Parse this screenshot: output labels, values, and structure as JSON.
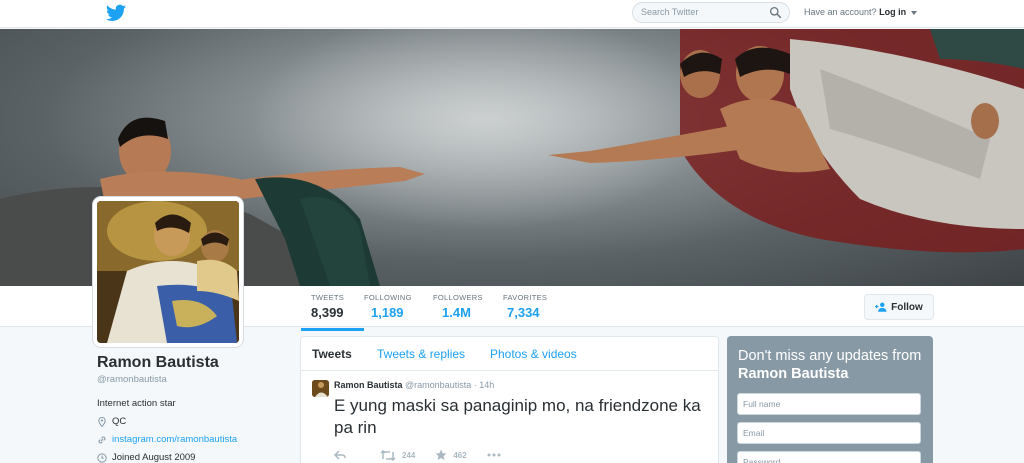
{
  "search": {
    "placeholder": "Search Twitter"
  },
  "account": {
    "prompt": "Have an account?",
    "login_label": "Log in"
  },
  "profile": {
    "name": "Ramon Bautista",
    "handle": "@ramonbautista",
    "bio": "Internet action star",
    "location": "QC",
    "website": "instagram.com/ramonbautista",
    "joined": "Joined August 2009"
  },
  "stats": [
    {
      "label": "TWEETS",
      "value": "8,399"
    },
    {
      "label": "FOLLOWING",
      "value": "1,189"
    },
    {
      "label": "FOLLOWERS",
      "value": "1.4M"
    },
    {
      "label": "FAVORITES",
      "value": "7,334"
    }
  ],
  "follow_label": "Follow",
  "tabs": [
    "Tweets",
    "Tweets & replies",
    "Photos & videos"
  ],
  "tweet": {
    "author": "Ramon Bautista",
    "handle": "@ramonbautista",
    "time": "· 14h",
    "text": "E yung maski sa panaginip mo, na friendzone ka pa rin",
    "retweets": "244",
    "favorites": "462"
  },
  "signup": {
    "heading_prefix": "Don't miss any updates from",
    "heading_name": "Ramon Bautista",
    "fields": [
      "Full name",
      "Email",
      "Password"
    ]
  },
  "colors": {
    "accent": "#1da1f2",
    "signup_bg": "#8899a6"
  },
  "icons": [
    "twitter-bird-icon",
    "search-icon",
    "location-pin-icon",
    "link-icon",
    "calendar-icon",
    "reply-icon",
    "retweet-icon",
    "favorite-star-icon",
    "more-dots-icon",
    "follow-user-icon"
  ]
}
